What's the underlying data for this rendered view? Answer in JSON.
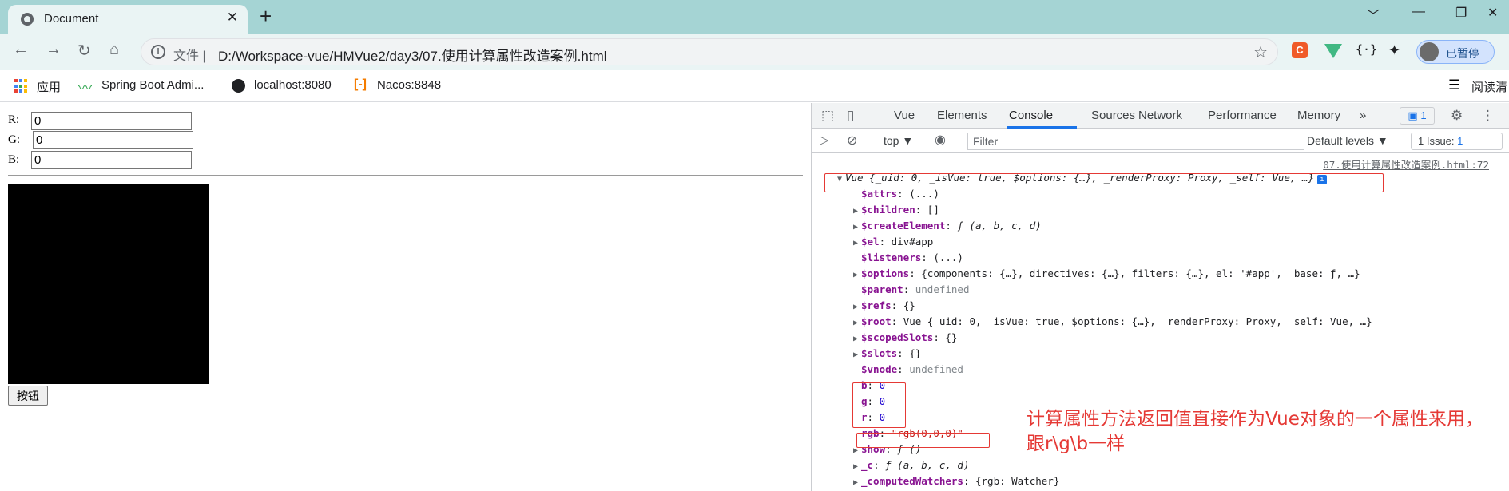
{
  "browser": {
    "tab_title": "Document",
    "tab_close": "✕",
    "new_tab": "+",
    "window_controls": [
      "﹀",
      "—",
      "❐",
      "✕"
    ],
    "nav": {
      "back": "←",
      "forward": "→",
      "reload": "↻",
      "home": "⌂"
    },
    "address": {
      "info_glyph": "i",
      "scheme_label": "文件 |",
      "url": "D:/Workspace-vue/HMVue2/day3/07.使用计算属性改造案例.html",
      "star": "☆"
    },
    "extensions": {
      "c_label": "C",
      "json_label": "{·}",
      "puzzle": "✦"
    },
    "profile_label": "已暂停",
    "bookmarks": [
      {
        "label": "应用"
      },
      {
        "label": "Spring Boot Admi..."
      },
      {
        "label": "localhost:8080"
      },
      {
        "label": "Nacos:8848"
      }
    ],
    "reading_list_label": "阅读清"
  },
  "page": {
    "fields": [
      {
        "label": "R:",
        "value": "0"
      },
      {
        "label": "G:",
        "value": "0"
      },
      {
        "label": "B:",
        "value": "0"
      }
    ],
    "box_color": "#000000",
    "button_label": "按钮"
  },
  "devtools": {
    "tabs": [
      "Vue",
      "Elements",
      "Console",
      "Sources",
      "Network",
      "Performance",
      "Memory"
    ],
    "active_tab": "Console",
    "more_tabs": "»",
    "message_count": "1",
    "context": "top ▼",
    "filter_placeholder": "Filter",
    "levels": "Default levels ▼",
    "issue_label": "1 Issue:",
    "issue_count": "1",
    "source_link": "07.使用计算属性改造案例.html:72",
    "object_header": "Vue {_uid: 0, _isVue: true, $options: {…}, _renderProxy: Proxy, _self: Vue, …}",
    "props": [
      {
        "expand": false,
        "key": "$attrs",
        "value": "(...)"
      },
      {
        "expand": true,
        "key": "$children",
        "value": "[]"
      },
      {
        "expand": true,
        "key": "$createElement",
        "value": "ƒ (a, b, c, d)"
      },
      {
        "expand": true,
        "key": "$el",
        "value": "div#app"
      },
      {
        "expand": false,
        "key": "$listeners",
        "value": "(...)"
      },
      {
        "expand": true,
        "key": "$options",
        "value": "{components: {…}, directives: {…}, filters: {…}, el: '#app', _base: ƒ, …}"
      },
      {
        "expand": false,
        "key": "$parent",
        "value": "undefined"
      },
      {
        "expand": true,
        "key": "$refs",
        "value": "{}"
      },
      {
        "expand": true,
        "key": "$root",
        "value": "Vue {_uid: 0, _isVue: true, $options: {…}, _renderProxy: Proxy, _self: Vue, …}"
      },
      {
        "expand": true,
        "key": "$scopedSlots",
        "value": "{}"
      },
      {
        "expand": true,
        "key": "$slots",
        "value": "{}"
      },
      {
        "expand": false,
        "key": "$vnode",
        "value": "undefined"
      },
      {
        "expand": false,
        "key": "b",
        "value": "0"
      },
      {
        "expand": false,
        "key": "g",
        "value": "0"
      },
      {
        "expand": false,
        "key": "r",
        "value": "0"
      },
      {
        "expand": false,
        "key": "rgb",
        "value": "\"rgb(0,0,0)\""
      },
      {
        "expand": true,
        "key": "show",
        "value": "ƒ ()"
      },
      {
        "expand": true,
        "key": "_c",
        "value": "ƒ (a, b, c, d)"
      },
      {
        "expand": true,
        "key": "_computedWatchers",
        "value": "{rgb: Watcher}"
      }
    ]
  },
  "annotation": "计算属性方法返回值直接作为Vue对象的一个属性来用，跟r\\g\\b一样",
  "colors": {
    "annotation_red": "#e53935",
    "tab_bar": "#a5d4d4",
    "devtools_accent": "#1a73e8"
  }
}
